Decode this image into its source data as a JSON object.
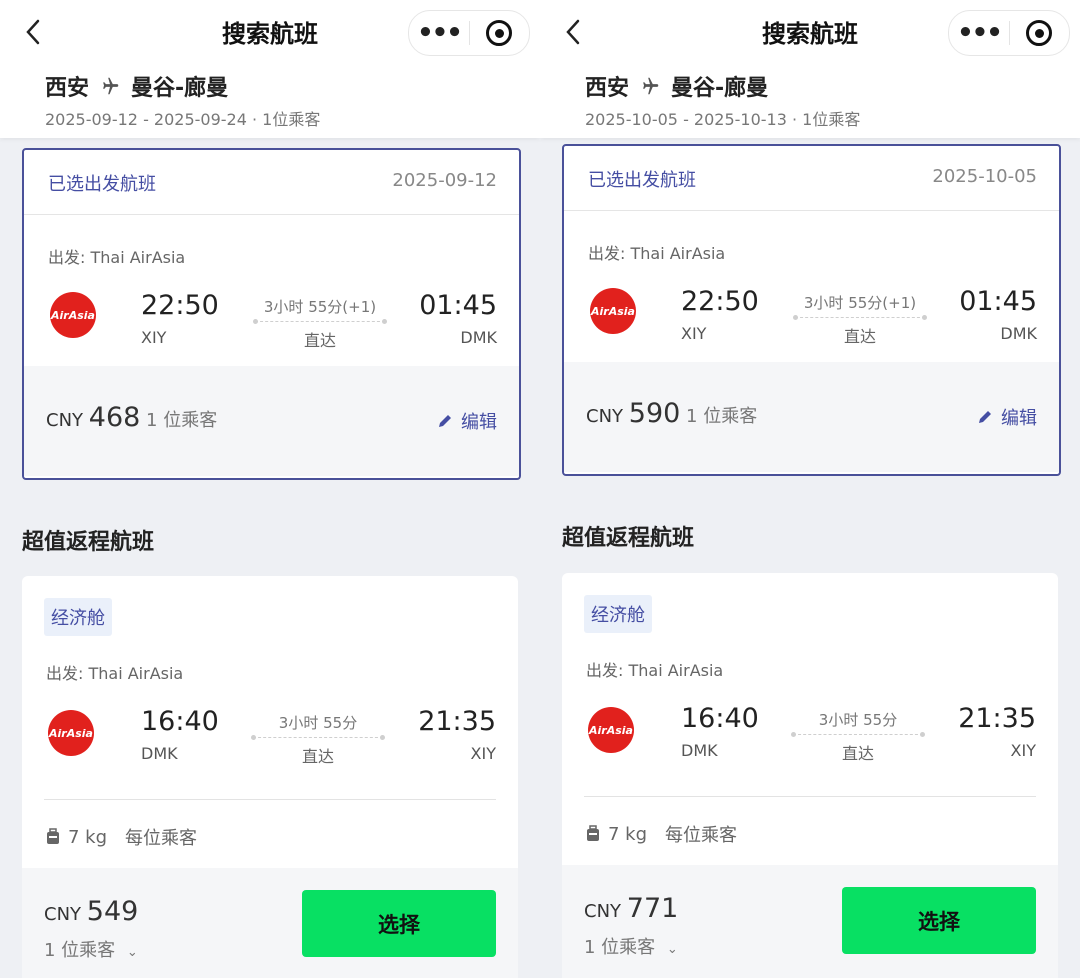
{
  "header": {
    "title": "搜索航班",
    "more_label": "•••"
  },
  "panels": [
    {
      "route_from": "西安",
      "route_to": "曼谷-廊曼",
      "dates_line": "2025-09-12 - 2025-09-24 · 1位乘客",
      "selected": {
        "label": "已选出发航班",
        "date": "2025-09-12",
        "airline_line": "出发: Thai AirAsia",
        "logo_text": "AirAsia",
        "dep_time": "22:50",
        "dep_code": "XIY",
        "duration": "3小时 55分(+1)",
        "stops": "直达",
        "arr_time": "01:45",
        "arr_code": "DMK",
        "currency": "CNY",
        "price": "468",
        "pax": "1 位乘客",
        "edit_label": "编辑"
      },
      "section_title": "超值返程航班",
      "return": {
        "cabin": "经济舱",
        "airline_line": "出发: Thai AirAsia",
        "logo_text": "AirAsia",
        "dep_time": "16:40",
        "dep_code": "DMK",
        "duration": "3小时 55分",
        "stops": "直达",
        "arr_time": "21:35",
        "arr_code": "XIY",
        "baggage_weight": "7 kg",
        "baggage_note": "每位乘客",
        "currency": "CNY",
        "price": "549",
        "pax": "1 位乘客",
        "select_label": "选择"
      }
    },
    {
      "route_from": "西安",
      "route_to": "曼谷-廊曼",
      "dates_line": "2025-10-05 - 2025-10-13 · 1位乘客",
      "selected": {
        "label": "已选出发航班",
        "date": "2025-10-05",
        "airline_line": "出发: Thai AirAsia",
        "logo_text": "AirAsia",
        "dep_time": "22:50",
        "dep_code": "XIY",
        "duration": "3小时 55分(+1)",
        "stops": "直达",
        "arr_time": "01:45",
        "arr_code": "DMK",
        "currency": "CNY",
        "price": "590",
        "pax": "1 位乘客",
        "edit_label": "编辑"
      },
      "section_title": "超值返程航班",
      "return": {
        "cabin": "经济舱",
        "airline_line": "出发: Thai AirAsia",
        "logo_text": "AirAsia",
        "dep_time": "16:40",
        "dep_code": "DMK",
        "duration": "3小时 55分",
        "stops": "直达",
        "arr_time": "21:35",
        "arr_code": "XIY",
        "baggage_weight": "7 kg",
        "baggage_note": "每位乘客",
        "currency": "CNY",
        "price": "771",
        "pax": "1 位乘客",
        "select_label": "选择"
      }
    }
  ],
  "colors": {
    "accent": "#454ea3",
    "select_button": "#08e063",
    "airline_logo": "#e1211d"
  }
}
